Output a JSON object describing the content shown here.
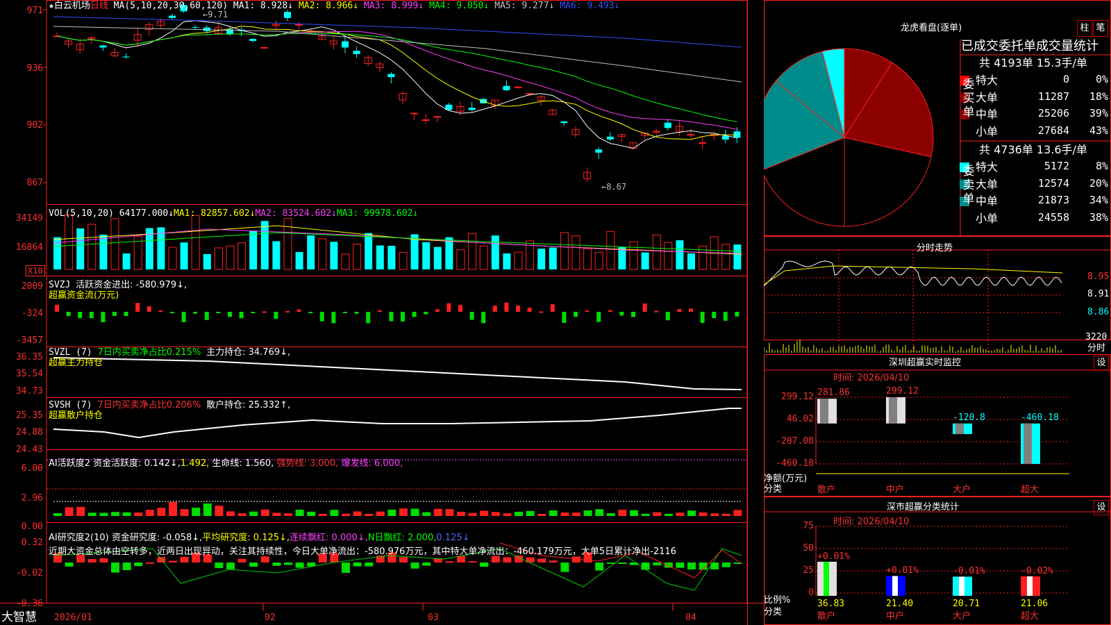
{
  "stock": {
    "name": "★白云机场",
    "period": "日线"
  },
  "main_panel": {
    "ma_label": "MA(5,10,20,30,60,120)",
    "ma_values": [
      {
        "name": "MA1:",
        "value": "8.928↓",
        "color": "#ffffff"
      },
      {
        "name": "MA2:",
        "value": "8.966↓",
        "color": "#ffff00"
      },
      {
        "name": "MA3:",
        "value": "8.999↓",
        "color": "#ff40ff"
      },
      {
        "name": "MA4:",
        "value": "9.050↓",
        "color": "#00ff00"
      },
      {
        "name": "MA5:",
        "value": "9.277↓",
        "color": "#c0c0c0"
      },
      {
        "name": "MA6:",
        "value": "9.493↓",
        "color": "#3050ff"
      }
    ],
    "y_ticks": [
      "971",
      "936",
      "902",
      "867"
    ],
    "high_annotation": "9.71",
    "low_annotation": "8.67"
  },
  "vol_panel": {
    "label": "VOL(5,10,20)",
    "value": "64177.000↓",
    "ma1": "MA1: 82857.602↓",
    "ma2": "MA2: 83524.602↓",
    "ma3": "MA3: 99978.602↓",
    "y_ticks": [
      "34149",
      "16864"
    ],
    "unit": "X10"
  },
  "svzj_panel": {
    "label": "SVZJ",
    "text": "活跃资金进出: -580.979↓,",
    "sub": "超赢资金流(万元)",
    "y_ticks": [
      "2009",
      "-324",
      "-3457"
    ]
  },
  "svzl_panel": {
    "label": "SVZL (7)",
    "text1": "7日内买卖净占比0.215%",
    "text2": "主力持仓: 34.769↓,",
    "sub": "超赢主力持仓",
    "y_ticks": [
      "36.35",
      "35.54",
      "34.73"
    ]
  },
  "svsh_panel": {
    "label": "SVSH (7)",
    "text1": "7日内买卖净占比0.206%",
    "text2": "散户持仓: 25.332↑,",
    "sub": "超赢散户持仓",
    "y_ticks": [
      "25.35",
      "24.88",
      "24.43"
    ]
  },
  "ai1_panel": {
    "label": "AI活跃度2",
    "text1": "资金活跃度: 0.142↓,",
    "text2": "1.492,",
    "text3": "生命线: 1.560,",
    "text4": "强势线: 3.000,",
    "text5": "爆发线: 6.000,",
    "y_ticks": [
      "6.00",
      "2.96",
      "0.00"
    ]
  },
  "ai2_panel": {
    "label": "AI研究度2(10)",
    "text1": "资金研究度: -0.058↓,",
    "text2": "平均研究度: 0.125↓,",
    "text3": "连续飘红: 0.000↓,",
    "text4": "N日飘红: 2.000,",
    "text5": "0.125↓",
    "commentary": "近期大资金总体由空转多，近两日出现异动，关注其持续性，今日大单净流出：-580.976万元，其中特大单净流出：-460.179万元，大单5日累计净出-2116",
    "y_ticks": [
      "0.32",
      "-0.02",
      "-0.36"
    ]
  },
  "x_axis": [
    "2026/01",
    "02",
    "03",
    "04"
  ],
  "logo": "大智慧",
  "right": {
    "dragon_title": "龙虎看盘(逐单)",
    "btn_pillar": "柱",
    "btn_pen": "笔",
    "stats_title": "已成交委托单成交量统计",
    "buy_side": "委买单",
    "sell_side": "委卖单",
    "buy_total": "共 4193单 15.3手/单",
    "sell_total": "共 4736单 13.6手/单",
    "buy_rows": [
      {
        "label": "特大",
        "value": "0",
        "pct": "0%",
        "color": "#ff0000"
      },
      {
        "label": "大单",
        "value": "11287",
        "pct": "18%",
        "color": "#8b0000"
      },
      {
        "label": "中单",
        "value": "25206",
        "pct": "39%",
        "color": "#8b0000"
      },
      {
        "label": "小单",
        "value": "27684",
        "pct": "43%",
        "color": "#000000"
      }
    ],
    "sell_rows": [
      {
        "label": "特大",
        "value": "5172",
        "pct": "8%",
        "color": "#00ffff"
      },
      {
        "label": "大单",
        "value": "12574",
        "pct": "20%",
        "color": "#008b8b"
      },
      {
        "label": "中单",
        "value": "21873",
        "pct": "34%",
        "color": "#008b8b"
      },
      {
        "label": "小单",
        "value": "24558",
        "pct": "38%",
        "color": "#000000"
      }
    ],
    "minute_title": "分时走势",
    "minute_ticks": [
      "8.95",
      "8.91",
      "8.86"
    ],
    "minute_vol": "3220",
    "minute_vol_unit": "分时",
    "sz_title": "深圳超赢实时监控",
    "settings": "设",
    "time_label": "时间: 2026/04/10",
    "net_label": "净额(万元)",
    "class_label": "分类",
    "sz_ticks": [
      "299.12",
      "46.02",
      "-207.08",
      "-460.18"
    ],
    "sz_values": [
      "281.86",
      "299.12",
      "-120.8",
      "-460.18"
    ],
    "categories": [
      "散户",
      "中户",
      "大户",
      "超大"
    ],
    "cls_title": "深市超赢分类统计",
    "ratio_label": "比例%",
    "cls_ticks": [
      "75",
      "50",
      "25",
      "0"
    ],
    "cls_changes": [
      "+0.01%",
      "+0.01%",
      "-0.01%",
      "-0.02%"
    ],
    "cls_values": [
      "36.83",
      "21.40",
      "20.71",
      "21.06"
    ]
  },
  "chart_data": [
    {
      "type": "bar",
      "title": "龙虎看盘(逐单) - 委买单",
      "categories": [
        "特大",
        "大单",
        "中单",
        "小单"
      ],
      "values": [
        0,
        11287,
        25206,
        27684
      ],
      "percent": [
        0,
        18,
        39,
        43
      ]
    },
    {
      "type": "bar",
      "title": "龙虎看盘(逐单) - 委卖单",
      "categories": [
        "特大",
        "大单",
        "中单",
        "小单"
      ],
      "values": [
        5172,
        12574,
        21873,
        24558
      ],
      "percent": [
        8,
        20,
        34,
        38
      ]
    },
    {
      "type": "bar",
      "title": "深圳超赢实时监控",
      "categories": [
        "散户",
        "中户",
        "大户",
        "超大"
      ],
      "values": [
        281.86,
        299.12,
        -120.8,
        -460.18
      ],
      "ylim": [
        -460.18,
        299.12
      ]
    },
    {
      "type": "bar",
      "title": "深市超赢分类统计",
      "categories": [
        "散户",
        "中户",
        "大户",
        "超大"
      ],
      "values": [
        36.83,
        21.4,
        20.71,
        21.06
      ],
      "ylim": [
        0,
        75
      ]
    }
  ]
}
